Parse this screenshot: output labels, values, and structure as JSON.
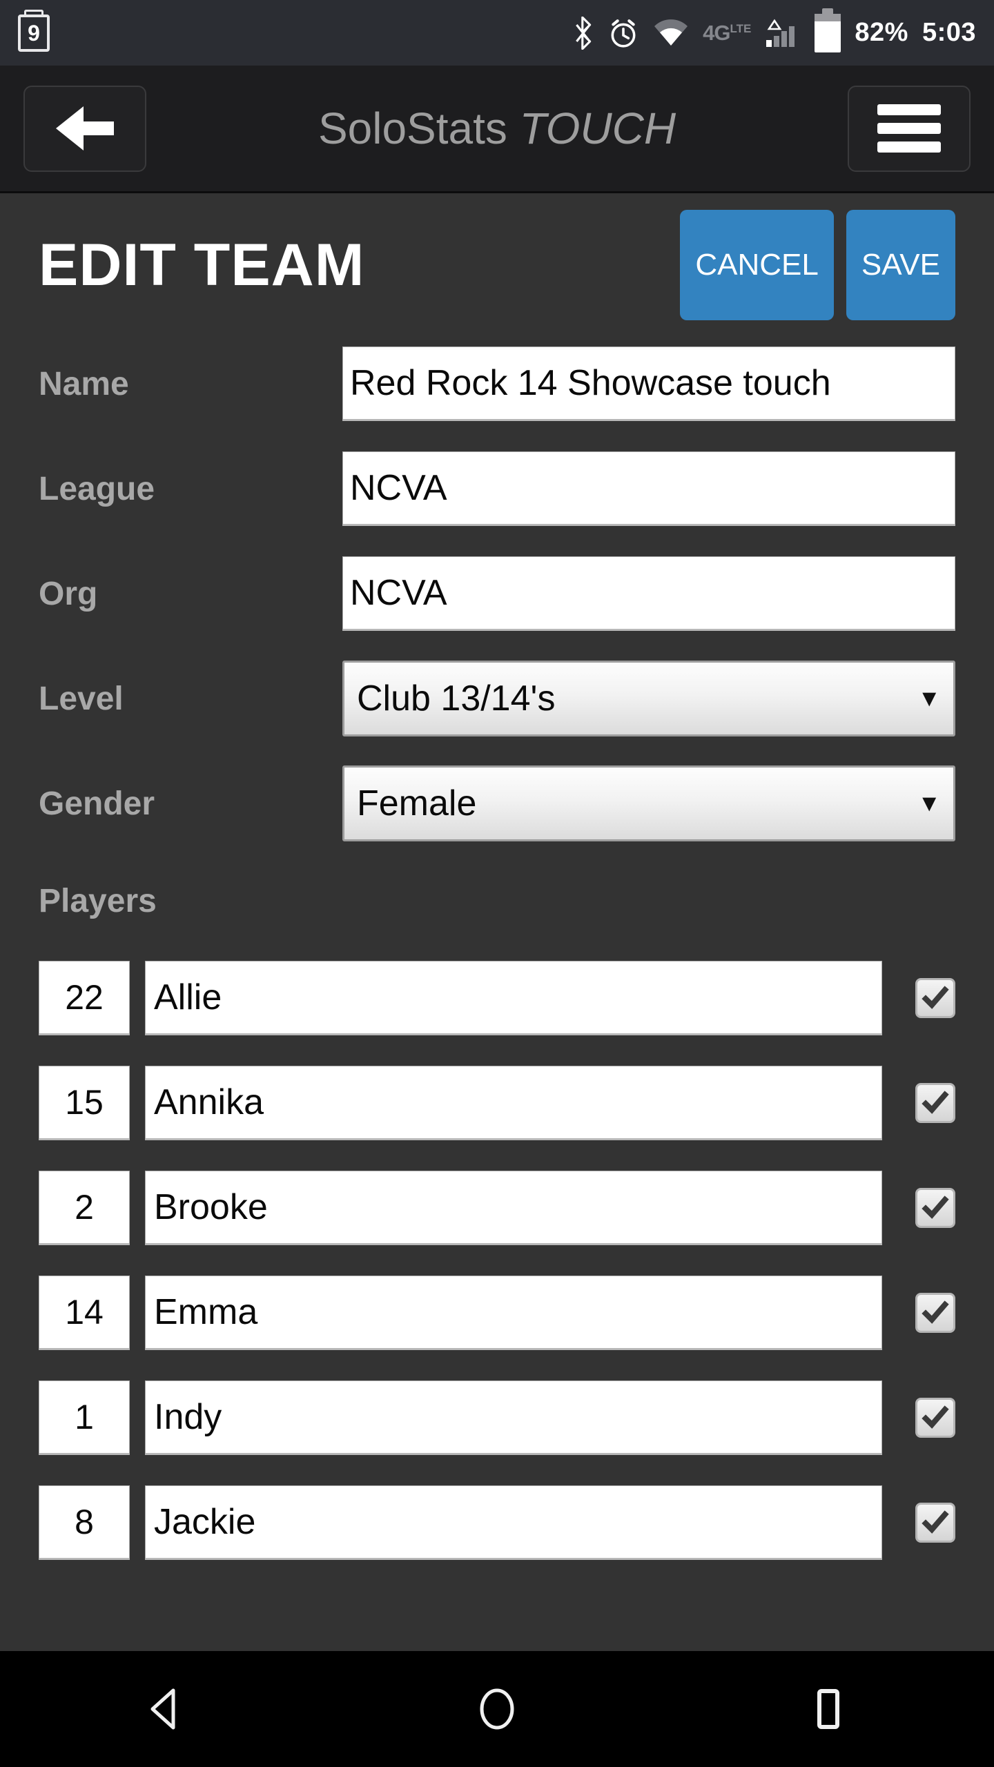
{
  "status_bar": {
    "notification_count": "9",
    "network_type": "4G",
    "network_tech": "LTE",
    "battery_percent": "82%",
    "time": "5:03",
    "icons": [
      "notification-badge-icon",
      "bluetooth-icon",
      "alarm-icon",
      "wifi-icon",
      "signal-icon",
      "battery-icon"
    ]
  },
  "title_bar": {
    "app_name": "SoloStats ",
    "app_name_italic": "TOUCH",
    "back_label": "back-arrow-icon",
    "menu_label": "hamburger-menu-icon"
  },
  "page": {
    "title": "EDIT TEAM",
    "cancel_label": "CANCEL",
    "save_label": "SAVE"
  },
  "form": {
    "name": {
      "label": "Name",
      "value": "Red Rock 14 Showcase touch"
    },
    "league": {
      "label": "League",
      "value": "NCVA"
    },
    "org": {
      "label": "Org",
      "value": "NCVA"
    },
    "level": {
      "label": "Level",
      "value": "Club 13/14's",
      "caret": "▼"
    },
    "gender": {
      "label": "Gender",
      "value": "Female",
      "caret": "▼"
    }
  },
  "players": {
    "label": "Players",
    "rows": [
      {
        "number": "22",
        "name": "Allie",
        "checked": true
      },
      {
        "number": "15",
        "name": "Annika",
        "checked": true
      },
      {
        "number": "2",
        "name": "Brooke",
        "checked": true
      },
      {
        "number": "14",
        "name": "Emma",
        "checked": true
      },
      {
        "number": "1",
        "name": "Indy",
        "checked": true
      },
      {
        "number": "8",
        "name": "Jackie",
        "checked": true
      }
    ]
  },
  "nav_bar": {
    "back": "nav-back-icon",
    "home": "nav-home-icon",
    "recents": "nav-recents-icon"
  },
  "colors": {
    "accent_blue": "#3383c0",
    "page_background": "#333333",
    "title_bar_background": "#1d1d1f",
    "status_bar_background": "#2b2d33",
    "label_text": "#a8a8a8",
    "nav_bar_background": "#000000"
  }
}
